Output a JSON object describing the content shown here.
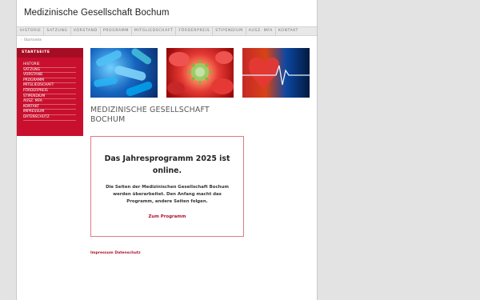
{
  "site": {
    "title": "Medizinische Gesellschaft Bochum"
  },
  "nav": {
    "items": [
      "HISTORIE",
      "SATZUNG",
      "VORSTAND",
      "PROGRAMM",
      "MITGLIEDSCHAFT",
      "FÖRDERPREIS",
      "STIPENDIUM",
      "AUSZ. MFA",
      "KONTAKT"
    ]
  },
  "breadcrumb": {
    "chevron": "›",
    "label": "Startseite"
  },
  "sidebar": {
    "heading": "STARTSEITE",
    "items": [
      "HISTORIE",
      "SATZUNG",
      "VORSTAND",
      "PROGRAMM",
      "MITGLIEDSCHAFT",
      "FÖRDERPREIS",
      "STIPENDIUM",
      "AUSZ. MFA",
      "KONTAKT",
      "IMPRESSUM",
      "DATENSCHUTZ"
    ]
  },
  "main": {
    "heading": "MEDIZINISCHE GESELLSCHAFT BOCHUM",
    "notice": {
      "title": "Das Jahresprogramm 2025 ist online.",
      "text": "Die Seiten der Medizinischen Gesellschaft Bochum werden überarbeitet. Den Anfang macht das Programm, andere Seiten folgen.",
      "link": "Zum Programm"
    }
  },
  "footer": {
    "impressum": "Impressum",
    "datenschutz": "Datenschutz"
  }
}
